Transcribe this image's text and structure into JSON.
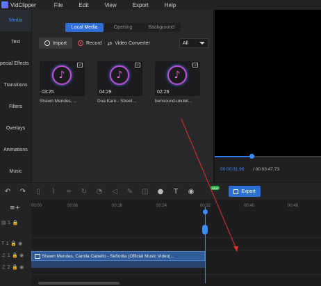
{
  "app": {
    "name": "VidClipper"
  },
  "menu": [
    "File",
    "Edit",
    "View",
    "Export",
    "Help"
  ],
  "sidebar": [
    {
      "label": "Media",
      "active": true
    },
    {
      "label": "Text"
    },
    {
      "label": "pecial Effects"
    },
    {
      "label": "Transitions"
    },
    {
      "label": "Filters"
    },
    {
      "label": "Overlays"
    },
    {
      "label": "Animations"
    },
    {
      "label": "Music"
    }
  ],
  "media_tabs": [
    {
      "label": "Local Media",
      "active": true
    },
    {
      "label": "Opening"
    },
    {
      "label": "Background"
    }
  ],
  "toolbar": {
    "import_label": "Import",
    "record_label": "Record",
    "converter_label": "Video Converter",
    "filter_value": "All"
  },
  "media_items": [
    {
      "duration": "03:25",
      "name": "Shawn Mendes, ...",
      "icon": "music-note-icon"
    },
    {
      "duration": "04:29",
      "name": "Dua Karo - Street...",
      "icon": "music-note-icon"
    },
    {
      "duration": "02:26",
      "name": "bensound-ukulel...",
      "icon": "music-note-icon"
    }
  ],
  "preview": {
    "current_time": "00:00:31.96",
    "total_time": "/ 00:03:47.73",
    "progress": 0.35
  },
  "export": {
    "label": "Export",
    "new_badge": "NEW"
  },
  "ruler": [
    "00:00",
    "00:08",
    "00:16",
    "00:24",
    "00:32",
    "00:40",
    "00:48"
  ],
  "clip": {
    "label": "Shawn Mendes, Camila Cabello - Señorita (Official Music Video)..."
  },
  "colors": {
    "accent": "#3d8bff",
    "annotation": "#e03030"
  }
}
